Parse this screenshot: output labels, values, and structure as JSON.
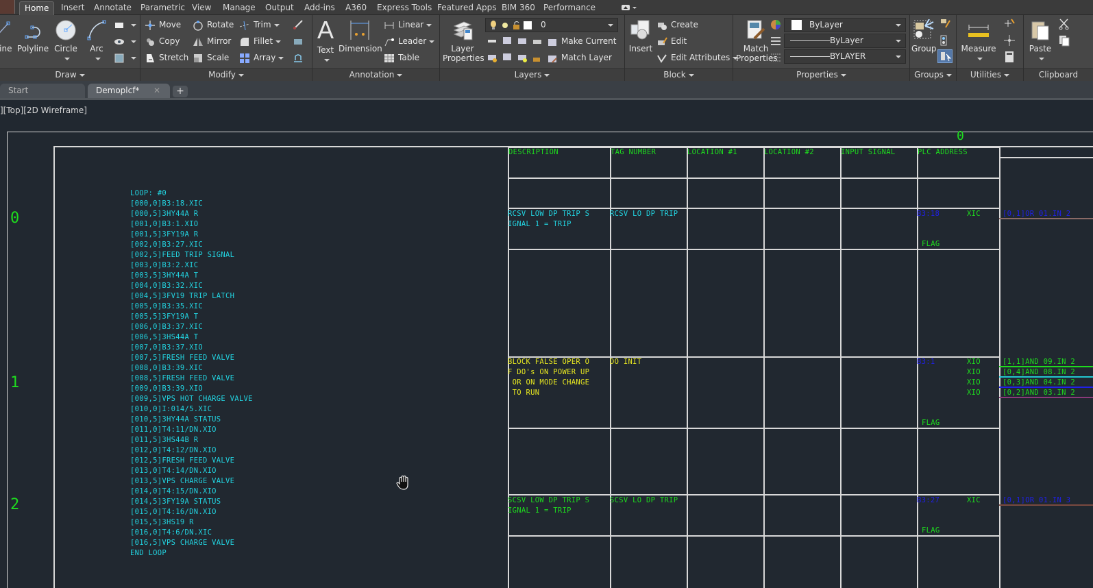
{
  "ribbon_tabs": [
    "Home",
    "Insert",
    "Annotate",
    "Parametric",
    "View",
    "Manage",
    "Output",
    "Add-ins",
    "A360",
    "Express Tools",
    "Featured Apps",
    "BIM 360",
    "Performance"
  ],
  "active_tab": "Home",
  "panels": {
    "draw": {
      "title": "Draw",
      "buttons": [
        "Line",
        "Polyline",
        "Circle",
        "Arc"
      ]
    },
    "modify": {
      "title": "Modify",
      "buttons": [
        "Move",
        "Rotate",
        "Trim",
        "Copy",
        "Mirror",
        "Fillet",
        "Stretch",
        "Scale",
        "Array"
      ]
    },
    "annotation": {
      "title": "Annotation",
      "buttons": [
        "Text",
        "Dimension",
        "Linear",
        "Leader",
        "Table"
      ]
    },
    "layers": {
      "title": "Layers",
      "layer_properties": "Layer Properties",
      "current_layer": "0",
      "make_current": "Make Current",
      "match_layer": "Match Layer"
    },
    "block": {
      "title": "Block",
      "insert": "Insert",
      "create": "Create",
      "edit": "Edit",
      "edit_attributes": "Edit Attributes"
    },
    "properties": {
      "title": "Properties",
      "match_properties": "Match Properties",
      "color": "ByLayer",
      "linetype": "ByLayer",
      "lineweight": "BYLAYER"
    },
    "groups": {
      "title": "Groups",
      "group": "Group"
    },
    "utilities": {
      "title": "Utilities",
      "measure": "Measure"
    },
    "clipboard": {
      "title": "Clipboard",
      "paste": "Paste"
    }
  },
  "doc_tabs": [
    {
      "label": "Start",
      "active": false
    },
    {
      "label": "Demoplcf*",
      "active": true
    }
  ],
  "viewport_label": "][Top][2D Wireframe]",
  "rung_numbers": [
    "0",
    "0",
    "1",
    "2"
  ],
  "loop_listing": [
    "LOOP: #0",
    "[000,0]B3:18.XIC",
    "[000,5]3HY44A R",
    "[001,0]B3:1.XIO",
    "[001,5]3FY19A R",
    "[002,0]B3:27.XIC",
    "[002,5]FEED TRIP SIGNAL",
    "[003,0]B3:2.XIC",
    "[003,5]3HY44A T",
    "[004,0]B3:32.XIC",
    "[004,5]3FV19 TRIP LATCH",
    "[005,0]B3:35.XIC",
    "[005,5]3FY19A T",
    "[006,0]B3:37.XIC",
    "[006,5]3HS44A T",
    "[007,0]B3:37.XIO",
    "[007,5]FRESH FEED VALVE",
    "[008,0]B3:39.XIC",
    "[008,5]FRESH FEED VALVE",
    "[009,0]B3:39.XIO",
    "[009,5]VPS HOT CHARGE VALVE",
    "[010,0]I:014/5.XIC",
    "[010,5]3HY44A STATUS",
    "[011,0]T4:11/DN.XIO",
    "[011,5]3HS44B R",
    "[012,0]T4:12/DN.XIO",
    "[012,5]FRESH FEED VALVE",
    "[013,0]T4:14/DN.XIO",
    "[013,5]VPS CHARGE VALVE",
    "[014,0]T4:15/DN.XIO",
    "[014,5]3FY19A STATUS",
    "[015,0]T4:16/DN.XIO",
    "[015,5]3HS19 R",
    "[016,0]T4:6/DN.XIC",
    "[016,5]VPS CHARGE VALVE",
    "END LOOP"
  ],
  "table": {
    "headers": [
      "DESCRIPTION",
      "TAG NUMBER",
      "LOCATION #1",
      "LOCATION #2",
      "INPUT SIGNAL",
      "PLC ADDRESS"
    ],
    "rows": [
      {
        "description": [
          "RCSV LOW DP TRIP S",
          "IGNAL 1 = TRIP"
        ],
        "tag": "RCSV LO DP TRIP",
        "address": "B3:18",
        "instructions": [
          "XIC"
        ],
        "flag": "FLAG",
        "links": [
          "[0,1]OR 01.IN 2"
        ],
        "color": "cyan"
      },
      {
        "description": [
          "BLOCK FALSE OPER O",
          "F DO's ON POWER UP",
          " OR ON MODE CHANGE",
          " TO RUN"
        ],
        "tag": "DO INIT",
        "address": "B3:1",
        "instructions": [
          "XIO",
          "XIO",
          "XIO",
          "XIO"
        ],
        "flag": "FLAG",
        "links": [
          "[1,1]AND 09.IN 2",
          "[0,4]AND 08.IN 2",
          "[0,3]AND 04.IN 2",
          "[0,2]AND 03.IN 2"
        ],
        "color": "yellow"
      },
      {
        "description": [
          "SCSV LOW DP TRIP S",
          "IGNAL 1 = TRIP"
        ],
        "tag": "SCSV LO DP TRIP",
        "address": "B3:27",
        "instructions": [
          "XIC"
        ],
        "flag": "FLAG",
        "links": [
          "[0,1]OR 01.IN 3"
        ],
        "color": "green"
      }
    ]
  }
}
